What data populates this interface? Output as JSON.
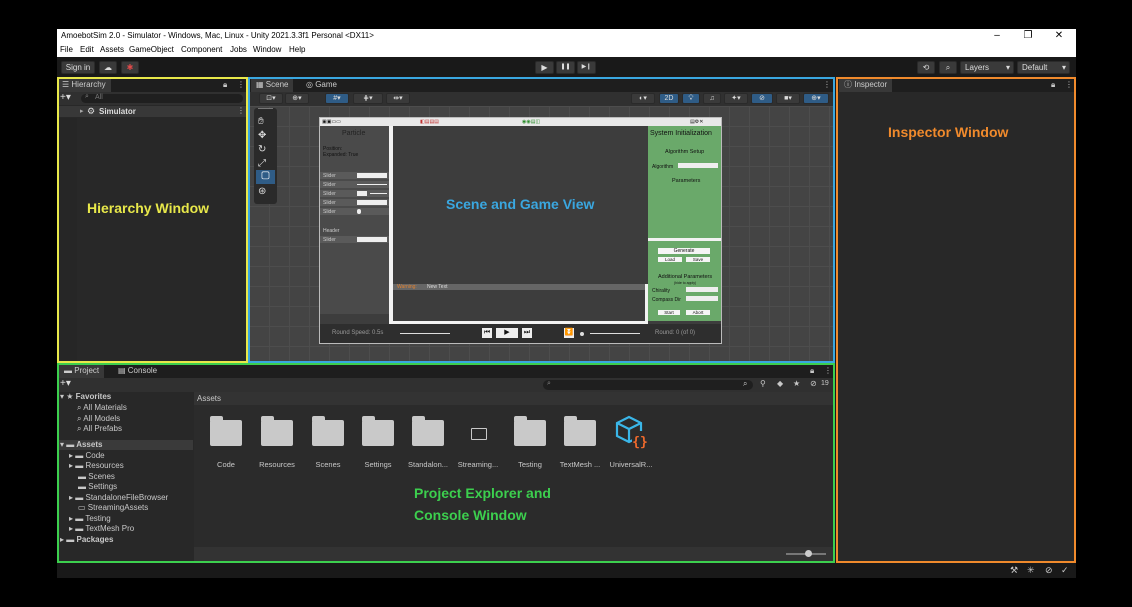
{
  "window": {
    "title": "AmoebotSim 2.0 - Simulator - Windows, Mac, Linux - Unity 2021.3.3f1 Personal <DX11>",
    "minimize": "–",
    "maximize": "❐",
    "close": "✕"
  },
  "menu": [
    "File",
    "Edit",
    "Assets",
    "GameObject",
    "Component",
    "Jobs",
    "Window",
    "Help"
  ],
  "toolbar": {
    "sign_in": "Sign in",
    "play": "▶",
    "pause": "❚❚",
    "step": "▶❙",
    "layers": "Layers",
    "layout": "Default"
  },
  "hierarchy": {
    "tab": "Hierarchy",
    "search_placeholder": "All",
    "root_item": "Simulator",
    "region_label": "Hierarchy Window"
  },
  "scene": {
    "tab_scene": "Scene",
    "tab_game": "Game",
    "region_label": "Scene and Game View",
    "view_2d": "2D",
    "game": {
      "particle_title": "Particle",
      "position_line": "Position:",
      "expanded_line": "Expanded: True",
      "sliders": [
        "Slider",
        "Slider",
        "Slider",
        "Slider",
        "Slider"
      ],
      "header": "Header",
      "slider_last": "Slider",
      "sys_title": "System Initialization",
      "algorithm_setup": "Algorithm Setup",
      "algorithm_label": "Algorithm",
      "parameters": "Parameters",
      "generate": "Generate",
      "load": "Load",
      "save": "Save",
      "additional_parameters": "Additional Parameters",
      "additional_sub": "(hide to apply)",
      "chirality": "Chirality",
      "compass_dir": "Compass Dir",
      "start": "Start",
      "abort": "Abort",
      "warning": "Warning:",
      "new_text": "New Text",
      "round_speed": "Round Speed: 0.5s",
      "round": "Round: 0 (of 0)"
    }
  },
  "inspector": {
    "tab": "Inspector",
    "region_label": "Inspector Window"
  },
  "project": {
    "tab_project": "Project",
    "tab_console": "Console",
    "region_label_line1": "Project Explorer and",
    "region_label_line2": "Console Window",
    "hidden_count": "19",
    "favorites": "Favorites",
    "fav_items": [
      "All Materials",
      "All Models",
      "All Prefabs"
    ],
    "assets_root": "Assets",
    "asset_tree": [
      "Code",
      "Resources",
      "Scenes",
      "Settings",
      "StandaloneFileBrowser",
      "StreamingAssets",
      "Testing",
      "TextMesh Pro"
    ],
    "packages": "Packages",
    "breadcrumb": "Assets",
    "grid_items": [
      "Code",
      "Resources",
      "Scenes",
      "Settings",
      "Standalon...",
      "Streaming...",
      "Testing",
      "TextMesh ...",
      "UniversalR..."
    ]
  },
  "colors": {
    "hierarchy_outline": "#e8e84a",
    "scene_outline": "#3aa7e0",
    "project_outline": "#3ccf4e",
    "inspector_outline": "#f08a2c",
    "game_panel_green": "#6aa96a"
  }
}
